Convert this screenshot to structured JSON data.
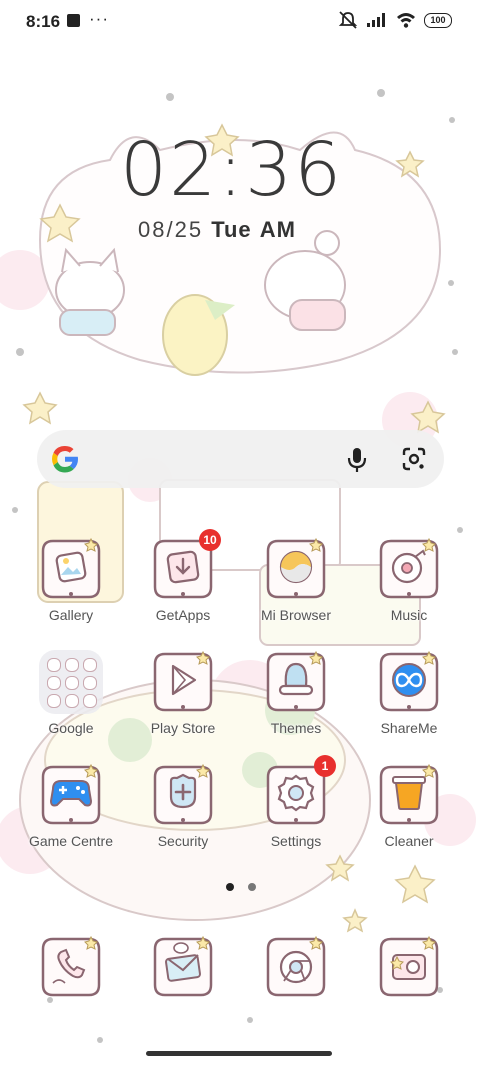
{
  "status_bar": {
    "time": "8:16",
    "dots": "···",
    "battery": "100"
  },
  "clock": {
    "time": "02:36",
    "date": "08/25",
    "day": "Tue",
    "ampm": "AM"
  },
  "search": {
    "google_letter": "G"
  },
  "apps_row1": [
    {
      "label": "Gallery"
    },
    {
      "label": "GetApps",
      "badge": "10"
    },
    {
      "label": "Mi Browser"
    },
    {
      "label": "Music"
    }
  ],
  "apps_row2": [
    {
      "label": "Google"
    },
    {
      "label": "Play Store"
    },
    {
      "label": "Themes"
    },
    {
      "label": "ShareMe"
    }
  ],
  "apps_row3": [
    {
      "label": "Game Centre"
    },
    {
      "label": "Security"
    },
    {
      "label": "Settings",
      "badge": "1"
    },
    {
      "label": "Cleaner"
    }
  ],
  "page_indicator": {
    "current": 1,
    "total": 2
  },
  "colors": {
    "icon_bg": "#fffafa",
    "icon_border": "#8a6670",
    "badge": "#e8302d",
    "accent_blue": "#2f8ff0",
    "accent_orange": "#f6a623"
  }
}
